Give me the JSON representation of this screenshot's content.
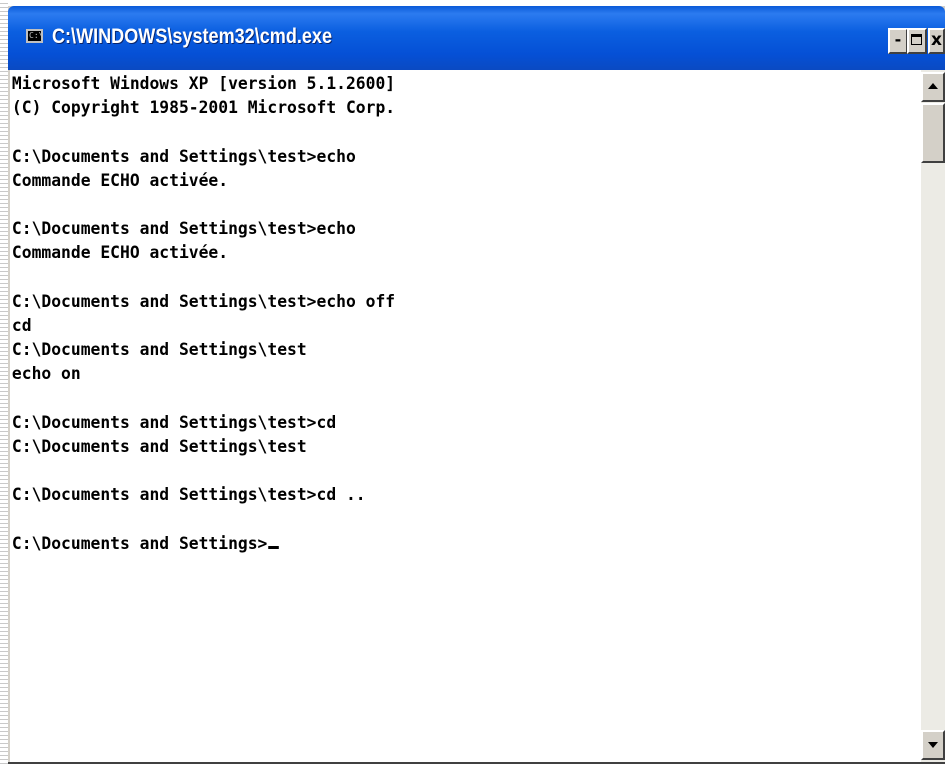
{
  "window": {
    "title": "C:\\WINDOWS\\system32\\cmd.exe",
    "icon": "console-icon",
    "icon_glyph": "C:\\",
    "controls": {
      "minimize": "-",
      "maximize_icon": "maximize-icon",
      "close": "x"
    }
  },
  "console": {
    "lines": [
      "Microsoft Windows XP [version 5.1.2600]",
      "(C) Copyright 1985-2001 Microsoft Corp.",
      "",
      "C:\\Documents and Settings\\test>echo",
      "Commande ECHO activée.",
      "",
      "C:\\Documents and Settings\\test>echo",
      "Commande ECHO activée.",
      "",
      "C:\\Documents and Settings\\test>echo off",
      "cd",
      "C:\\Documents and Settings\\test",
      "echo on",
      "",
      "C:\\Documents and Settings\\test>cd",
      "C:\\Documents and Settings\\test",
      "",
      "C:\\Documents and Settings\\test>cd ..",
      "",
      "C:\\Documents and Settings>"
    ]
  },
  "scrollbar": {
    "up_icon": "arrow-up-icon",
    "down_icon": "arrow-down-icon"
  },
  "colors": {
    "titlebar": "#0550d6",
    "console_background": "#ffffff",
    "console_text": "#000000",
    "chrome": "#d4d0c8"
  }
}
